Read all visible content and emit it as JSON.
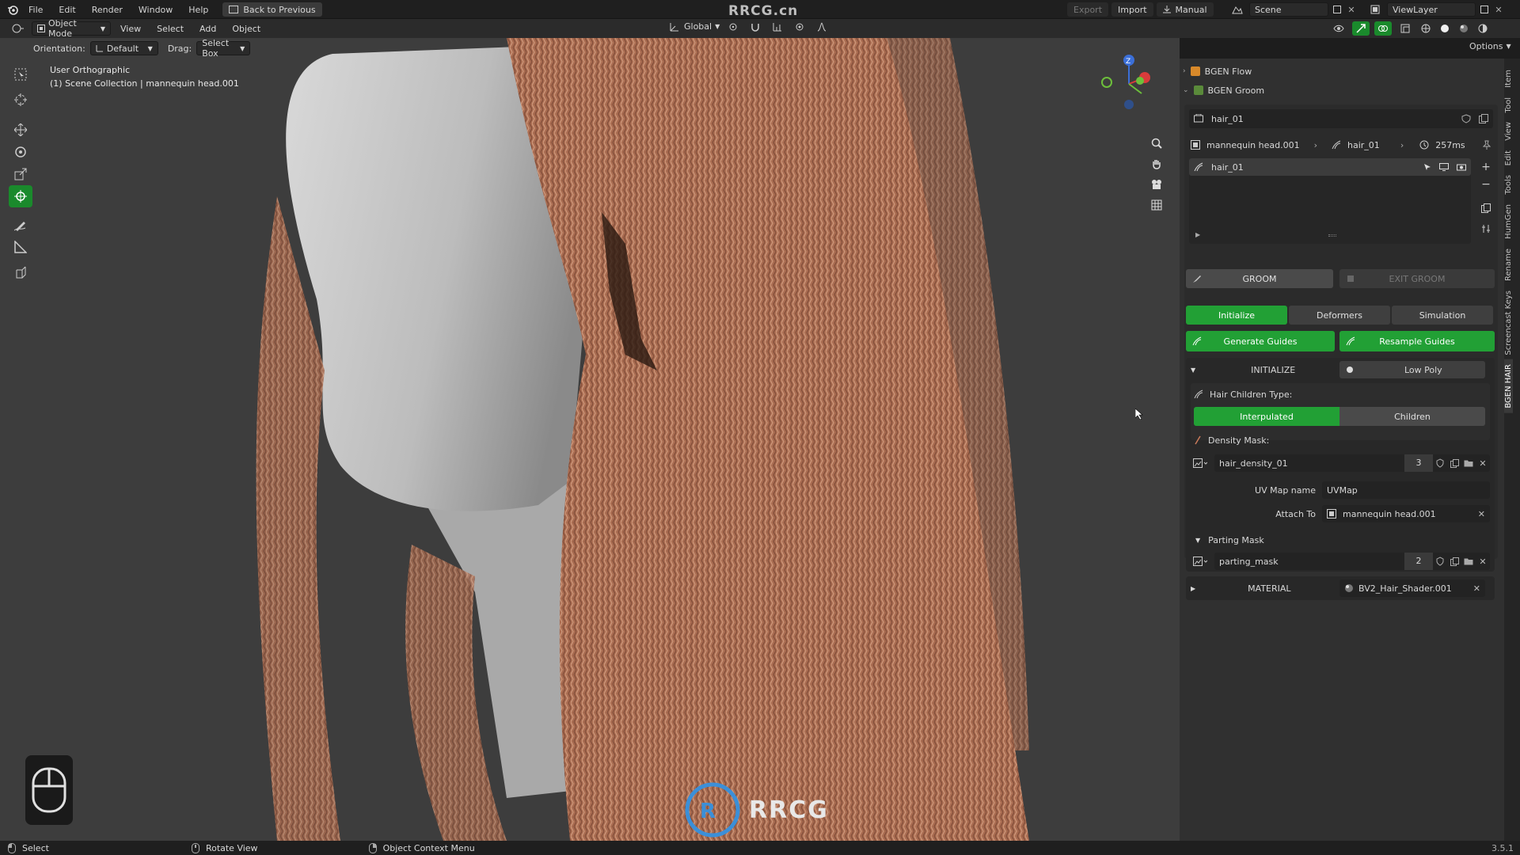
{
  "topbar": {
    "menus": [
      "File",
      "Edit",
      "Render",
      "Window",
      "Help"
    ],
    "back_label": "Back to Previous",
    "watermark": "RRCG.cn",
    "export_label": "Export",
    "import_label": "Import",
    "manual_label": "Manual",
    "scene_label": "Scene",
    "viewlayer_label": "ViewLayer"
  },
  "header": {
    "mode": "Object Mode",
    "menus": [
      "View",
      "Select",
      "Add",
      "Object"
    ],
    "transform_orientation": "Global",
    "options_label": "Options"
  },
  "toolsettings": {
    "orientation_label": "Orientation:",
    "orientation_value": "Default",
    "drag_label": "Drag:",
    "drag_value": "Select Box"
  },
  "viewport": {
    "view_name": "User Orthographic",
    "collection_info": "(1) Scene Collection | mannequin head.001",
    "gizmo_z": "Z",
    "background_color": "#3d3d3d",
    "hair_color": "#b87a5c"
  },
  "panel": {
    "sections": {
      "bgen_flow": "BGEN Flow",
      "bgen_groom": "BGEN Groom"
    },
    "groom_name": "hair_01",
    "breadcrumb": {
      "object": "mannequin head.001",
      "system": "hair_01",
      "time": "257ms"
    },
    "list_item": "hair_01",
    "groom_button": "GROOM",
    "exit_groom_button": "EXIT GROOM",
    "tabs": [
      "Initialize",
      "Deformers",
      "Simulation"
    ],
    "generate_guides": "Generate Guides",
    "resample_guides": "Resample Guides",
    "initialize_header": "INITIALIZE",
    "low_poly": "Low Poly",
    "hair_children_type_label": "Hair Children Type:",
    "children_types": [
      "Interpulated",
      "Children"
    ],
    "density_mask_label": "Density Mask:",
    "density_texture": "hair_density_01",
    "density_users": "3",
    "uv_map_label": "UV Map name",
    "uv_map_value": "UVMap",
    "attach_to_label": "Attach To",
    "attach_to_value": "mannequin head.001",
    "parting_mask_header": "Parting Mask",
    "parting_texture": "parting_mask",
    "parting_users": "2",
    "material_header": "MATERIAL",
    "material_value": "BV2_Hair_Shader.001",
    "accent_color": "#22a035"
  },
  "vtabs": [
    "Item",
    "Tool",
    "View",
    "Edit",
    "Tools",
    "HumGen",
    "Rename",
    "Screencast Keys",
    "BGEN HAIR"
  ],
  "statusbar": {
    "select": "Select",
    "rotate": "Rotate View",
    "context": "Object Context Menu",
    "version": "3.5.1"
  }
}
